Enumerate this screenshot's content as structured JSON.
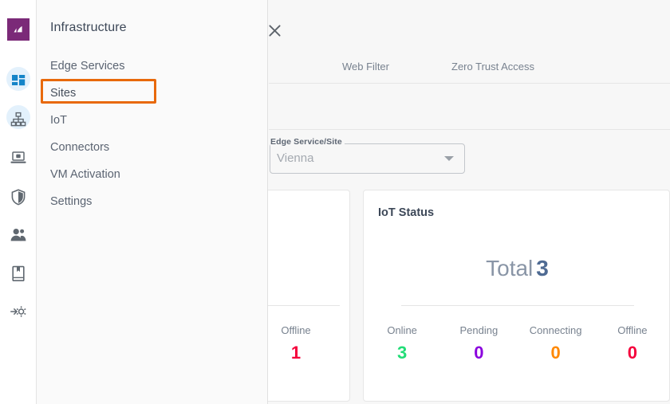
{
  "rail": {
    "brand": {
      "name": "app-logo",
      "color": "#7b2a78"
    },
    "items": [
      {
        "name": "dashboard-icon",
        "active": true
      },
      {
        "name": "network-icon",
        "active": true
      },
      {
        "name": "endpoint-icon",
        "active": false
      },
      {
        "name": "security-icon",
        "active": false
      },
      {
        "name": "users-icon",
        "active": false
      },
      {
        "name": "reports-icon",
        "active": false
      },
      {
        "name": "integration-icon",
        "active": false
      }
    ]
  },
  "drawer": {
    "title": "Infrastructure",
    "close_label": "✕",
    "items": [
      {
        "label": "Edge Services",
        "highlighted": false
      },
      {
        "label": "Sites",
        "highlighted": true
      },
      {
        "label": "IoT",
        "highlighted": false
      },
      {
        "label": "Connectors",
        "highlighted": false
      },
      {
        "label": "VM Activation",
        "highlighted": false
      },
      {
        "label": "Settings",
        "highlighted": false
      }
    ],
    "highlight_color": "#e8690b"
  },
  "tabs": [
    {
      "label": "Web Filter"
    },
    {
      "label": "Zero Trust Access"
    }
  ],
  "filter": {
    "select_label": "Edge Service/Site",
    "select_value": "Vienna",
    "select_placeholder": "Vienna"
  },
  "cards": {
    "partial": {
      "stat_label": "Offline",
      "stat_value": "1",
      "stat_color": "#f5003c"
    },
    "iot": {
      "title": "IoT Status",
      "total_word": "Total",
      "total_value": "3",
      "stats": [
        {
          "label": "Online",
          "value": "3",
          "color": "#22dd77"
        },
        {
          "label": "Pending",
          "value": "0",
          "color": "#8a00dd"
        },
        {
          "label": "Connecting",
          "value": "0",
          "color": "#ff8800"
        },
        {
          "label": "Offline",
          "value": "0",
          "color": "#f5003c"
        }
      ]
    }
  }
}
